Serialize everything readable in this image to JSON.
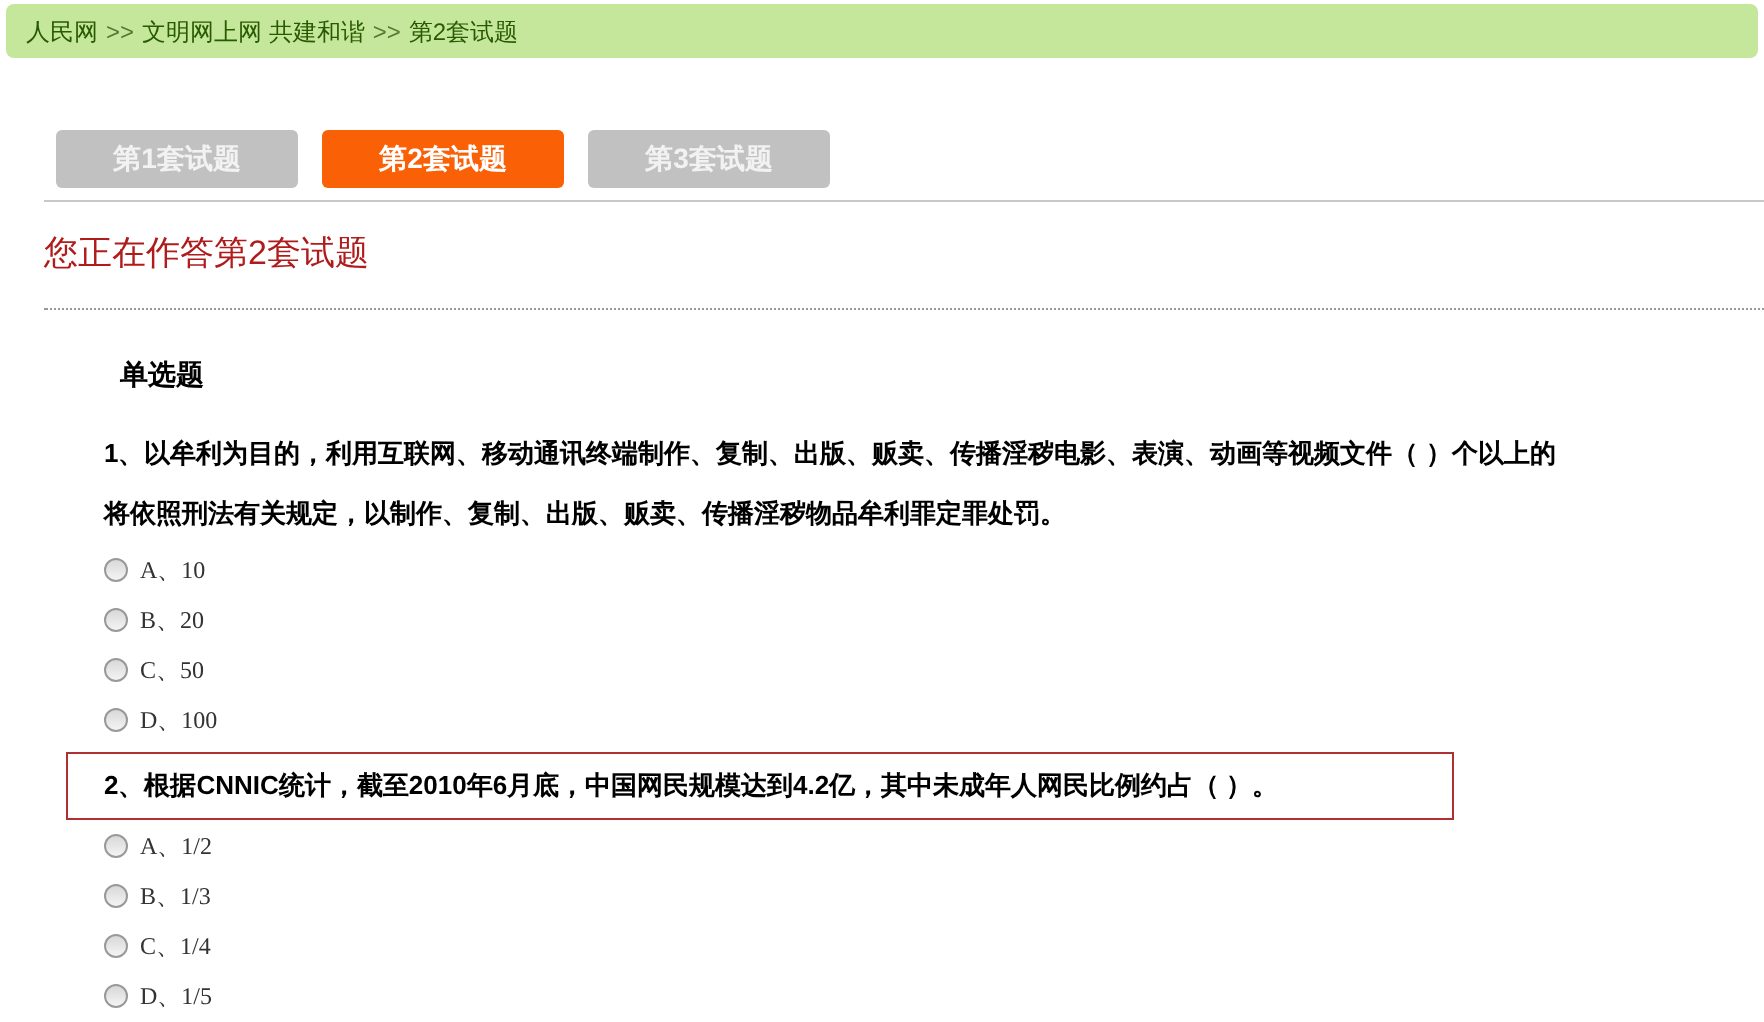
{
  "breadcrumb": [
    {
      "kind": "link",
      "text": "人民网"
    },
    {
      "kind": "separator",
      "text": ">>"
    },
    {
      "kind": "link",
      "text": "文明网上网 共建和谐"
    },
    {
      "kind": "separator",
      "text": ">>"
    },
    {
      "kind": "link",
      "text": "第2套试题"
    }
  ],
  "tabs": [
    {
      "label": "第1套试题",
      "selected": false
    },
    {
      "label": "第2套试题",
      "selected": true
    },
    {
      "label": "第3套试题",
      "selected": false
    }
  ],
  "heading": "您正在作答第2套试题",
  "section_title": "单选题",
  "questions": [
    {
      "lines": [
        "1、以牟利为目的，利用互联网、移动通讯终端制作、复制、出版、贩卖、传播淫秽电影、表演、动画等视频文件（ ）个以上的",
        "将依照刑法有关规定，以制作、复制、出版、贩卖、传播淫秽物品牟利罪定罪处罚。"
      ],
      "highlighted": false,
      "options": [
        {
          "label": "A、10",
          "selected": false
        },
        {
          "label": "B、20",
          "selected": false
        },
        {
          "label": "C、50",
          "selected": false
        },
        {
          "label": "D、100",
          "selected": false
        }
      ]
    },
    {
      "lines": [
        "2、根据CNNIC统计，截至2010年6月底，中国网民规模达到4.2亿，其中未成年人网民比例约占（ ）。"
      ],
      "highlighted": true,
      "options": [
        {
          "label": "A、1/2",
          "selected": false
        },
        {
          "label": "B、1/3",
          "selected": false
        },
        {
          "label": "C、1/4",
          "selected": false
        },
        {
          "label": "D、1/5",
          "selected": false
        }
      ]
    }
  ]
}
